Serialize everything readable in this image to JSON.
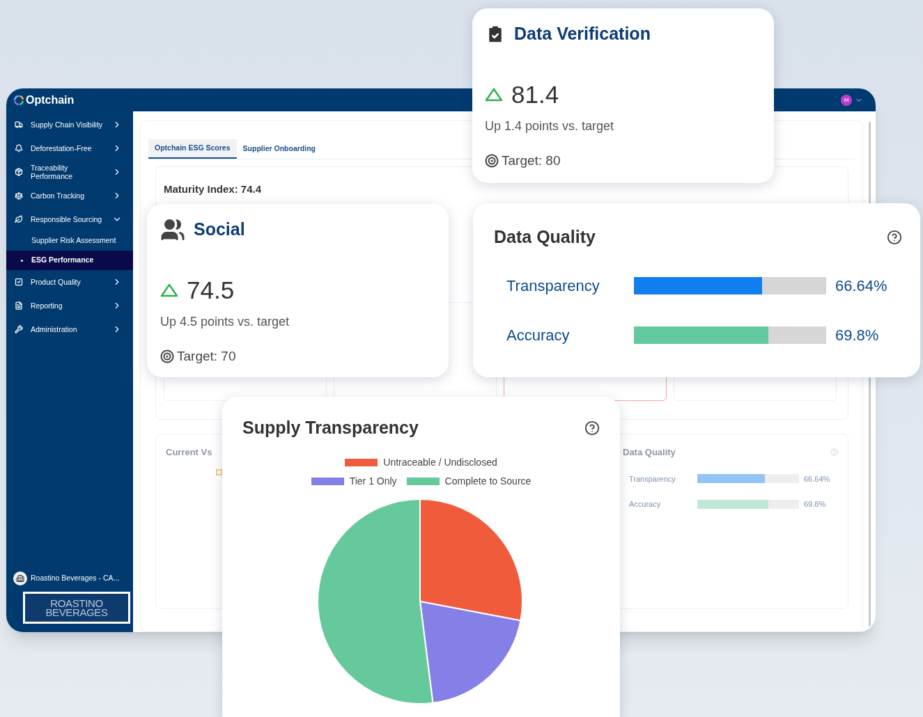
{
  "app_window": {
    "brand": "Optchain",
    "avatar_initial": "M",
    "sidebar": {
      "items": [
        {
          "label": "Supply Chain Visibility",
          "selected": false,
          "expanded": false
        },
        {
          "label": "Deforestation-Free",
          "selected": false,
          "expanded": false
        },
        {
          "label": "Traceability Performance",
          "selected": false,
          "expanded": false
        },
        {
          "label": "Carbon Tracking",
          "selected": false,
          "expanded": false
        },
        {
          "label": "Responsible Sourcing",
          "selected": false,
          "expanded": true,
          "children": [
            {
              "label": "Supplier Risk Assessment",
              "selected": false
            },
            {
              "label": "ESG Performance",
              "selected": true
            }
          ]
        },
        {
          "label": "Product Quality",
          "selected": false,
          "expanded": false
        },
        {
          "label": "Reporting",
          "selected": false,
          "expanded": false
        },
        {
          "label": "Administration",
          "selected": false,
          "expanded": false
        }
      ],
      "account": "Roastino Beverages - CA...",
      "logo_lines": [
        "ROASTINO",
        "BEVERAGES"
      ]
    },
    "tabs": [
      {
        "label": "Optchain ESG Scores",
        "selected": true
      },
      {
        "label": "Supplier Onboarding",
        "selected": false
      }
    ],
    "maturity_index": "Maturity Index: 74.4",
    "score_cards": [
      {
        "alert": false
      },
      {
        "alert": false
      },
      {
        "alert": true
      },
      {
        "alert": false
      }
    ],
    "comparison_panel": {
      "title": "Current Vs"
    },
    "data_quality_panel": {
      "title": "Data Quality",
      "rows": [
        {
          "label": "Transparency",
          "level": 0.6664,
          "reading": "66.64%",
          "color": "#93c3f5"
        },
        {
          "label": "Accuracy",
          "level": 0.698,
          "reading": "69.8%",
          "color": "#bfe8d6"
        }
      ]
    }
  },
  "verification_card": {
    "title": "Data Verification",
    "up": true,
    "value": "81.4",
    "change": "Up 1.4 points vs. target",
    "target": "Target: 80"
  },
  "social_card": {
    "title": "Social",
    "up": true,
    "value": "74.5",
    "change": "Up 4.5 points vs. target",
    "target": "Target: 70"
  },
  "quality_card": {
    "title": "Data Quality",
    "rows": [
      {
        "label": "Transparency",
        "level": 0.6664,
        "reading": "66.64%",
        "color": "#0f7ff0"
      },
      {
        "label": "Accuracy",
        "level": 0.698,
        "reading": "69.8%",
        "color": "#62c89d"
      }
    ]
  },
  "transparency_card": {
    "title": "Supply Transparency",
    "chart_data": {
      "type": "pie",
      "categories": [
        "Untraceable / Undisclosed",
        "Tier 1 Only",
        "Complete to Source"
      ],
      "series": [
        {
          "values": [
            28,
            20,
            52
          ]
        }
      ],
      "colors": [
        "#f05c3b",
        "#8580e8",
        "#66c99c"
      ]
    }
  }
}
